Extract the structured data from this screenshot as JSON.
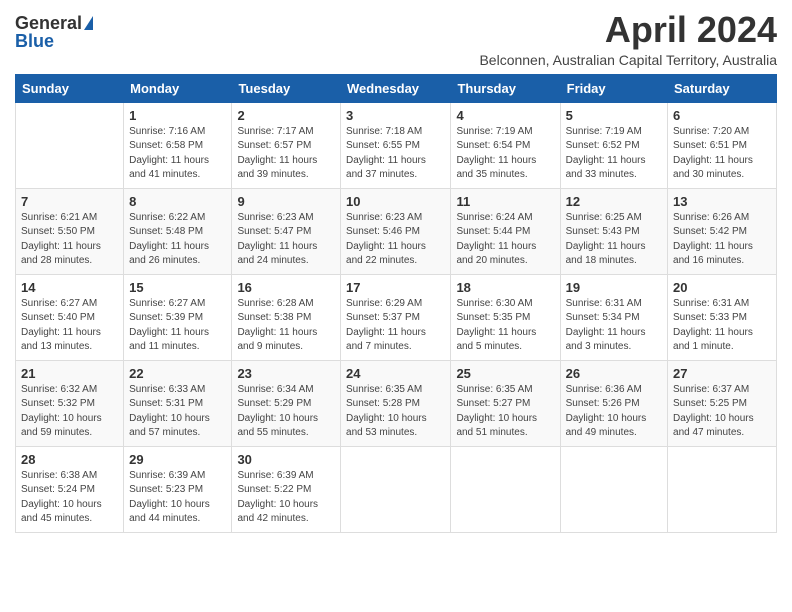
{
  "logo": {
    "general": "General",
    "blue": "Blue"
  },
  "title": "April 2024",
  "subtitle": "Belconnen, Australian Capital Territory, Australia",
  "weekdays": [
    "Sunday",
    "Monday",
    "Tuesday",
    "Wednesday",
    "Thursday",
    "Friday",
    "Saturday"
  ],
  "weeks": [
    [
      {
        "day": "",
        "info": ""
      },
      {
        "day": "1",
        "info": "Sunrise: 7:16 AM\nSunset: 6:58 PM\nDaylight: 11 hours\nand 41 minutes."
      },
      {
        "day": "2",
        "info": "Sunrise: 7:17 AM\nSunset: 6:57 PM\nDaylight: 11 hours\nand 39 minutes."
      },
      {
        "day": "3",
        "info": "Sunrise: 7:18 AM\nSunset: 6:55 PM\nDaylight: 11 hours\nand 37 minutes."
      },
      {
        "day": "4",
        "info": "Sunrise: 7:19 AM\nSunset: 6:54 PM\nDaylight: 11 hours\nand 35 minutes."
      },
      {
        "day": "5",
        "info": "Sunrise: 7:19 AM\nSunset: 6:52 PM\nDaylight: 11 hours\nand 33 minutes."
      },
      {
        "day": "6",
        "info": "Sunrise: 7:20 AM\nSunset: 6:51 PM\nDaylight: 11 hours\nand 30 minutes."
      }
    ],
    [
      {
        "day": "7",
        "info": "Sunrise: 6:21 AM\nSunset: 5:50 PM\nDaylight: 11 hours\nand 28 minutes."
      },
      {
        "day": "8",
        "info": "Sunrise: 6:22 AM\nSunset: 5:48 PM\nDaylight: 11 hours\nand 26 minutes."
      },
      {
        "day": "9",
        "info": "Sunrise: 6:23 AM\nSunset: 5:47 PM\nDaylight: 11 hours\nand 24 minutes."
      },
      {
        "day": "10",
        "info": "Sunrise: 6:23 AM\nSunset: 5:46 PM\nDaylight: 11 hours\nand 22 minutes."
      },
      {
        "day": "11",
        "info": "Sunrise: 6:24 AM\nSunset: 5:44 PM\nDaylight: 11 hours\nand 20 minutes."
      },
      {
        "day": "12",
        "info": "Sunrise: 6:25 AM\nSunset: 5:43 PM\nDaylight: 11 hours\nand 18 minutes."
      },
      {
        "day": "13",
        "info": "Sunrise: 6:26 AM\nSunset: 5:42 PM\nDaylight: 11 hours\nand 16 minutes."
      }
    ],
    [
      {
        "day": "14",
        "info": "Sunrise: 6:27 AM\nSunset: 5:40 PM\nDaylight: 11 hours\nand 13 minutes."
      },
      {
        "day": "15",
        "info": "Sunrise: 6:27 AM\nSunset: 5:39 PM\nDaylight: 11 hours\nand 11 minutes."
      },
      {
        "day": "16",
        "info": "Sunrise: 6:28 AM\nSunset: 5:38 PM\nDaylight: 11 hours\nand 9 minutes."
      },
      {
        "day": "17",
        "info": "Sunrise: 6:29 AM\nSunset: 5:37 PM\nDaylight: 11 hours\nand 7 minutes."
      },
      {
        "day": "18",
        "info": "Sunrise: 6:30 AM\nSunset: 5:35 PM\nDaylight: 11 hours\nand 5 minutes."
      },
      {
        "day": "19",
        "info": "Sunrise: 6:31 AM\nSunset: 5:34 PM\nDaylight: 11 hours\nand 3 minutes."
      },
      {
        "day": "20",
        "info": "Sunrise: 6:31 AM\nSunset: 5:33 PM\nDaylight: 11 hours\nand 1 minute."
      }
    ],
    [
      {
        "day": "21",
        "info": "Sunrise: 6:32 AM\nSunset: 5:32 PM\nDaylight: 10 hours\nand 59 minutes."
      },
      {
        "day": "22",
        "info": "Sunrise: 6:33 AM\nSunset: 5:31 PM\nDaylight: 10 hours\nand 57 minutes."
      },
      {
        "day": "23",
        "info": "Sunrise: 6:34 AM\nSunset: 5:29 PM\nDaylight: 10 hours\nand 55 minutes."
      },
      {
        "day": "24",
        "info": "Sunrise: 6:35 AM\nSunset: 5:28 PM\nDaylight: 10 hours\nand 53 minutes."
      },
      {
        "day": "25",
        "info": "Sunrise: 6:35 AM\nSunset: 5:27 PM\nDaylight: 10 hours\nand 51 minutes."
      },
      {
        "day": "26",
        "info": "Sunrise: 6:36 AM\nSunset: 5:26 PM\nDaylight: 10 hours\nand 49 minutes."
      },
      {
        "day": "27",
        "info": "Sunrise: 6:37 AM\nSunset: 5:25 PM\nDaylight: 10 hours\nand 47 minutes."
      }
    ],
    [
      {
        "day": "28",
        "info": "Sunrise: 6:38 AM\nSunset: 5:24 PM\nDaylight: 10 hours\nand 45 minutes."
      },
      {
        "day": "29",
        "info": "Sunrise: 6:39 AM\nSunset: 5:23 PM\nDaylight: 10 hours\nand 44 minutes."
      },
      {
        "day": "30",
        "info": "Sunrise: 6:39 AM\nSunset: 5:22 PM\nDaylight: 10 hours\nand 42 minutes."
      },
      {
        "day": "",
        "info": ""
      },
      {
        "day": "",
        "info": ""
      },
      {
        "day": "",
        "info": ""
      },
      {
        "day": "",
        "info": ""
      }
    ]
  ]
}
